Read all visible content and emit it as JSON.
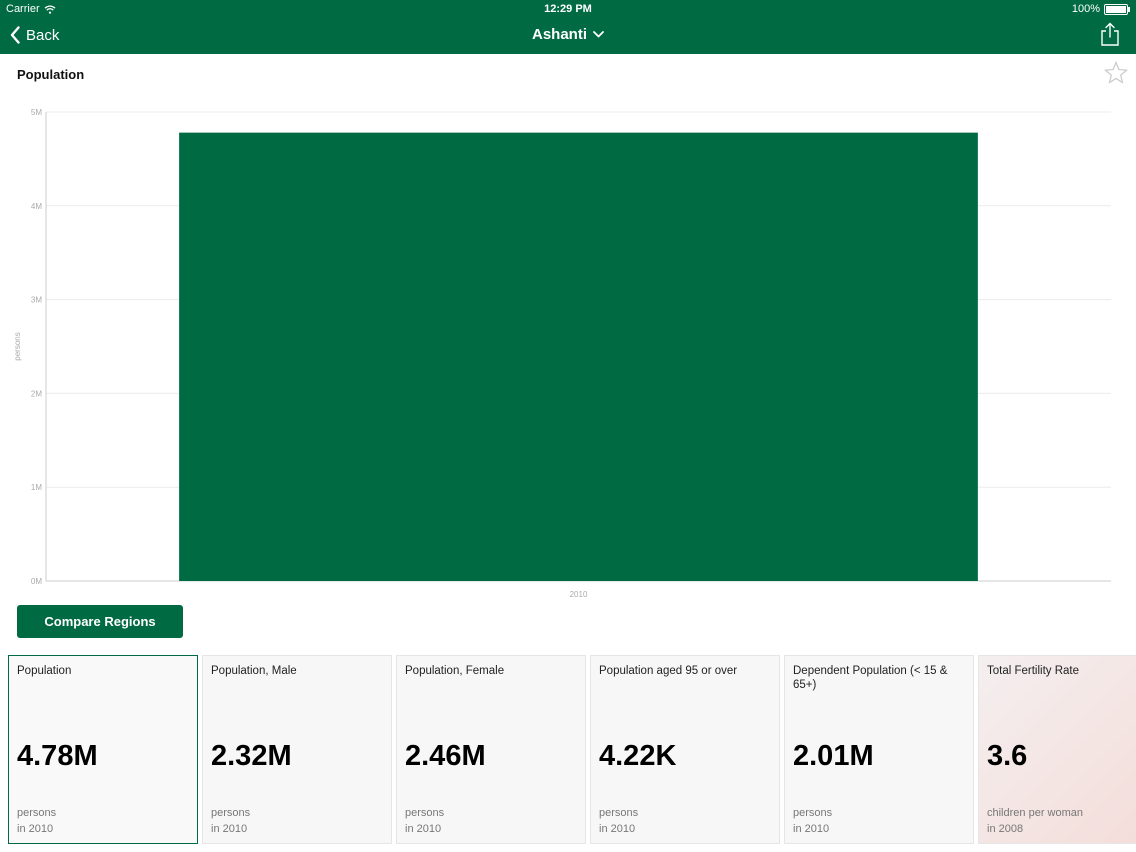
{
  "status_bar": {
    "carrier": "Carrier",
    "time": "12:29 PM",
    "battery": "100%"
  },
  "nav": {
    "back_label": "Back",
    "title": "Ashanti"
  },
  "chart_title": "Population",
  "chart_data": {
    "type": "bar",
    "categories": [
      "2010"
    ],
    "values": [
      4780000
    ],
    "ylabel": "persons",
    "ylim": [
      0,
      5000000
    ],
    "y_ticks": [
      {
        "value": 0,
        "label": "0M"
      },
      {
        "value": 1000000,
        "label": "1M"
      },
      {
        "value": 2000000,
        "label": "2M"
      },
      {
        "value": 3000000,
        "label": "3M"
      },
      {
        "value": 4000000,
        "label": "4M"
      },
      {
        "value": 5000000,
        "label": "5M"
      }
    ],
    "grid": true,
    "color": "#006b42"
  },
  "compare_label": "Compare Regions",
  "cards": [
    {
      "label": "Population",
      "value": "4.78M",
      "unit": "persons",
      "year": "in 2010",
      "selected": true
    },
    {
      "label": "Population, Male",
      "value": "2.32M",
      "unit": "persons",
      "year": "in 2010"
    },
    {
      "label": "Population, Female",
      "value": "2.46M",
      "unit": "persons",
      "year": "in 2010"
    },
    {
      "label": "Population aged 95 or over",
      "value": "4.22K",
      "unit": "persons",
      "year": "in 2010"
    },
    {
      "label": "Dependent Population (< 15 & 65+)",
      "value": "2.01M",
      "unit": "persons",
      "year": "in 2010"
    },
    {
      "label": "Total Fertility Rate",
      "value": "3.6",
      "unit": "children per woman",
      "year": "in 2008",
      "trend_icon": "arrow-down-icon"
    }
  ],
  "colors": {
    "brand": "#006b42",
    "trend_down": "#d2453a"
  }
}
